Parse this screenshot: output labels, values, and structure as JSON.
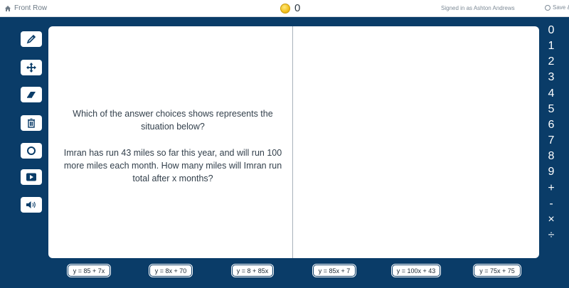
{
  "topbar": {
    "home_label": "Front Row",
    "coin_count": "0",
    "signed_in": "Signed in as Ashton Andrews",
    "save_label": "Save & C"
  },
  "toolbar": {
    "tools": [
      "pencil-icon",
      "move-icon",
      "eraser-icon",
      "trash-icon",
      "circle-icon",
      "video-icon",
      "speaker-icon"
    ]
  },
  "question": {
    "prompt": "Which of the answer choices shows represents the situation below?",
    "situation": "Imran has run 43 miles so far this year, and will run 100 more miles each month. How many miles will Imran run total after x months?"
  },
  "keypad": {
    "keys": [
      "0",
      "1",
      "2",
      "3",
      "4",
      "5",
      "6",
      "7",
      "8",
      "9",
      "+",
      "-",
      "×",
      "÷"
    ]
  },
  "answers": [
    "y = 85 + 7x",
    "y = 8x + 70",
    "y = 8 + 85x",
    "y = 85x + 7",
    "y = 100x + 43",
    "y = 75x + 75"
  ],
  "colors": {
    "background": "#0a3c68",
    "card": "#ffffff",
    "text": "#33404c"
  }
}
